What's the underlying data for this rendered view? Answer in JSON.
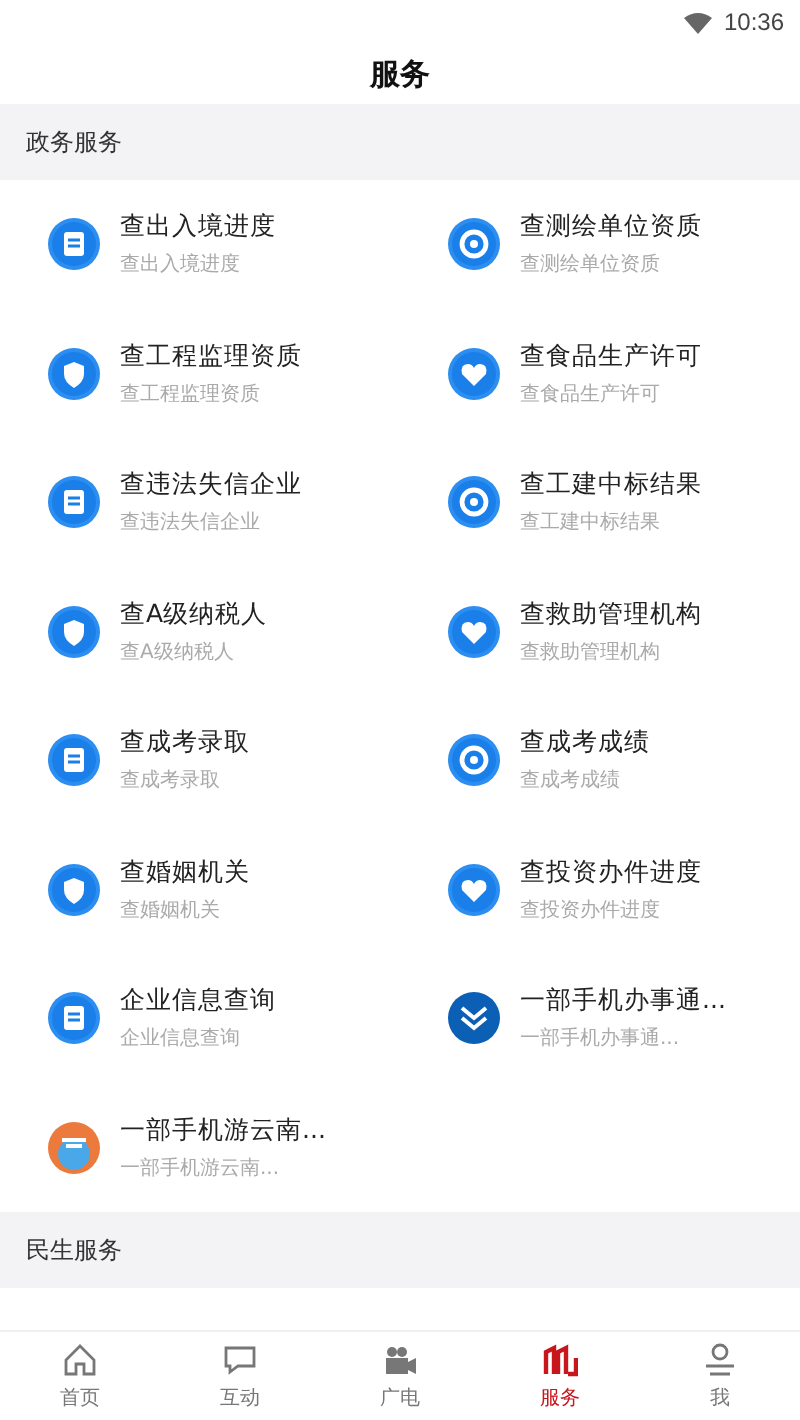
{
  "status_bar": {
    "time": "10:36"
  },
  "title": "服务",
  "sections": [
    {
      "title": "政务服务",
      "items": [
        {
          "title": "查出入境进度",
          "subtitle": "查出入境进度"
        },
        {
          "title": "查测绘单位资质",
          "subtitle": "查测绘单位资质"
        },
        {
          "title": "查工程监理资质",
          "subtitle": "查工程监理资质"
        },
        {
          "title": "查食品生产许可",
          "subtitle": "查食品生产许可"
        },
        {
          "title": "查违法失信企业",
          "subtitle": "查违法失信企业"
        },
        {
          "title": "查工建中标结果",
          "subtitle": "查工建中标结果"
        },
        {
          "title": "查A级纳税人",
          "subtitle": "查A级纳税人"
        },
        {
          "title": "查救助管理机构",
          "subtitle": "查救助管理机构"
        },
        {
          "title": "查成考录取",
          "subtitle": "查成考录取"
        },
        {
          "title": "查成考成绩",
          "subtitle": "查成考成绩"
        },
        {
          "title": "查婚姻机关",
          "subtitle": "查婚姻机关"
        },
        {
          "title": "查投资办件进度",
          "subtitle": "查投资办件进度"
        },
        {
          "title": "企业信息查询",
          "subtitle": "企业信息查询"
        },
        {
          "title": "一部手机办事通...",
          "subtitle": "一部手机办事通..."
        },
        {
          "title": "一部手机游云南...",
          "subtitle": "一部手机游云南..."
        }
      ]
    },
    {
      "title": "民生服务"
    }
  ],
  "tab_bar": [
    {
      "label": "首页",
      "selected": false
    },
    {
      "label": "互动",
      "selected": false
    },
    {
      "label": "广电",
      "selected": false
    },
    {
      "label": "服务",
      "selected": true
    },
    {
      "label": "我",
      "selected": false
    }
  ]
}
